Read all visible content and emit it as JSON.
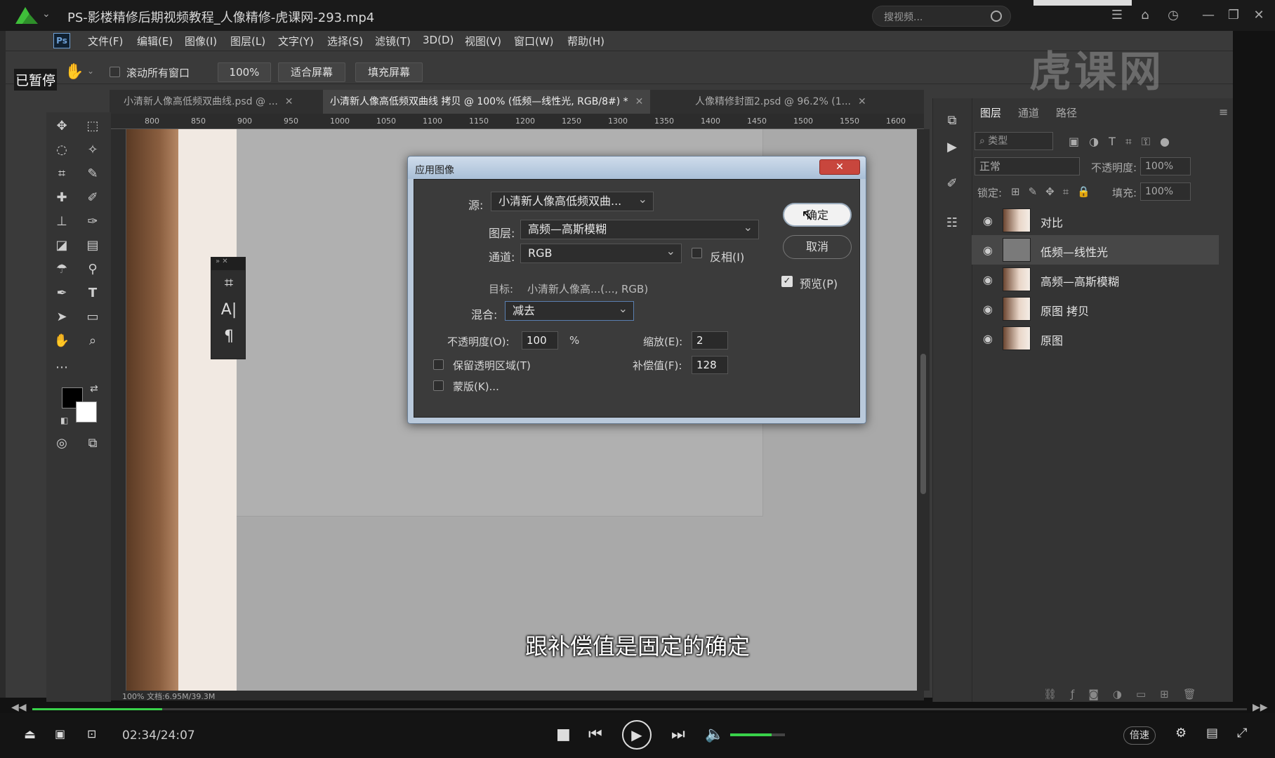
{
  "player": {
    "title": "PS-影楼精修后期视频教程_人像精修-虎课网-293.mp4",
    "search_placeholder": "搜视频...",
    "paused_label": "已暂停",
    "subtitle": "跟补偿值是固定的确定",
    "time": "02:34/24:07",
    "progress": 0.107,
    "volume": 0.75,
    "speed_label": "倍速",
    "accent": "#39d24a"
  },
  "ps": {
    "logo": "Ps",
    "menu": [
      "文件(F)",
      "编辑(E)",
      "图像(I)",
      "图层(L)",
      "文字(Y)",
      "选择(S)",
      "滤镜(T)",
      "3D(D)",
      "视图(V)",
      "窗口(W)",
      "帮助(H)"
    ],
    "options": {
      "scroll_all_label": "滚动所有窗口",
      "zoom_value": "100%",
      "fit_screen": "适合屏幕",
      "fill_screen": "填充屏幕"
    },
    "tabs": [
      {
        "label": "小清新人像高低频双曲线.psd @ ...",
        "active": false
      },
      {
        "label": "小清新人像高低频双曲线 拷贝 @ 100% (低频—线性光, RGB/8#) *",
        "active": true
      },
      {
        "label": "人像精修封面2.psd @ 96.2% (1...",
        "active": false
      }
    ],
    "ruler_ticks": [
      "800",
      "850",
      "900",
      "950",
      "1000",
      "1050",
      "1100",
      "1150",
      "1200",
      "1250",
      "1300",
      "1350",
      "1400",
      "1450",
      "1500",
      "1550",
      "1600"
    ],
    "status": "100%      文档:6.95M/39.3M"
  },
  "dialog": {
    "title": "应用图像",
    "close": "✕",
    "source_label": "源:",
    "source_value": "小清新人像高低频双曲...",
    "layer_label": "图层:",
    "layer_value": "高频—高斯模糊",
    "channel_label": "通道:",
    "channel_value": "RGB",
    "invert_label": "反相(I)",
    "target_label": "目标:",
    "target_value": "小清新人像高...(..., RGB)",
    "blending_label": "混合:",
    "blending_value": "减去",
    "opacity_label": "不透明度(O):",
    "opacity_value": "100",
    "percent": "%",
    "scale_label": "缩放(E):",
    "scale_value": "2",
    "offset_label": "补偿值(F):",
    "offset_value": "128",
    "preserve_label": "保留透明区域(T)",
    "mask_label": "蒙版(K)...",
    "ok": "确定",
    "cancel": "取消",
    "preview_label": "预览(P)",
    "preview_checked": true
  },
  "layers_panel": {
    "tabs": [
      "图层",
      "通道",
      "路径"
    ],
    "filter_label": "类型",
    "blend_mode": "正常",
    "opacity_label": "不透明度:",
    "opacity_value": "100%",
    "lock_label": "锁定:",
    "fill_label": "填充:",
    "fill_value": "100%",
    "layers": [
      {
        "name": "对比",
        "selected": false
      },
      {
        "name": "低频—线性光",
        "selected": true
      },
      {
        "name": "高频—高斯模糊",
        "selected": false
      },
      {
        "name": "原图 拷贝",
        "selected": false
      },
      {
        "name": "原图",
        "selected": false
      }
    ]
  },
  "watermark": "虎课网"
}
